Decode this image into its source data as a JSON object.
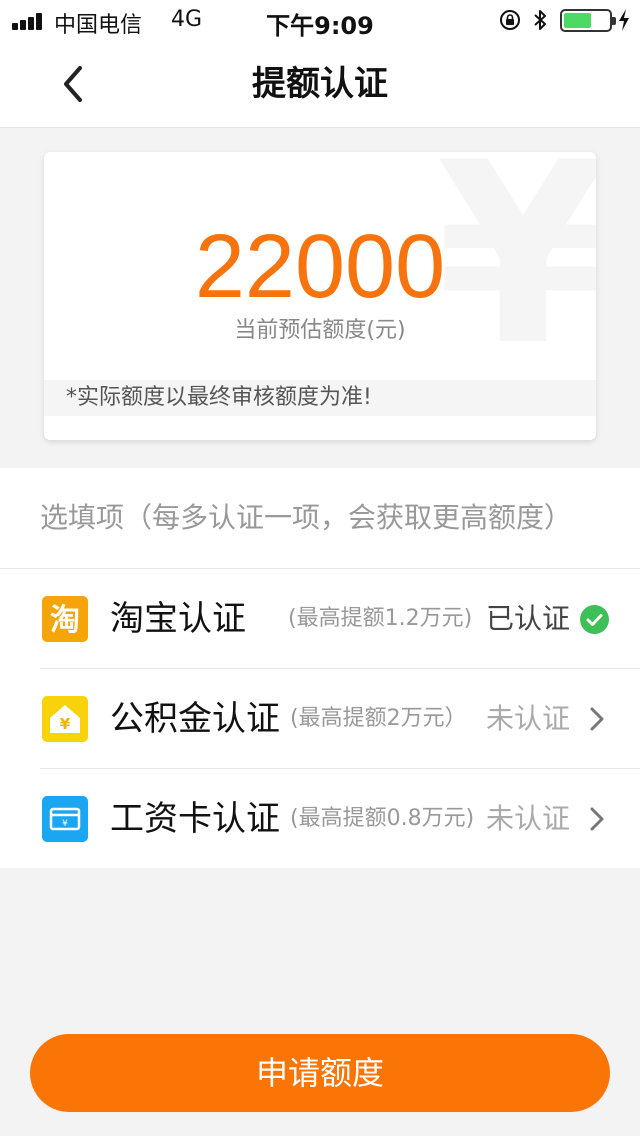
{
  "status_bar": {
    "carrier": "中国电信",
    "network": "4G",
    "time": "下午9:09",
    "battery_level_percent": 65,
    "battery_color": "#4cd964"
  },
  "nav": {
    "back_icon": "chevron-left-icon",
    "title": "提额认证"
  },
  "amount_card": {
    "watermark": "¥",
    "amount": "22000",
    "caption": "当前预估额度(元)",
    "note": "*实际额度以最终审核额度为准!",
    "accent_color": "#f7730e"
  },
  "options": {
    "header": "选填项（每多认证一项，会获取更高额度）",
    "items": [
      {
        "icon": "taobao-icon",
        "icon_glyph": "淘",
        "icon_color": "#f5a50a",
        "title": "淘宝认证",
        "hint": "(最高提额1.2万元)",
        "status": "已认证",
        "status_icon": "check-circle-icon",
        "status_color": "#3fbf58"
      },
      {
        "icon": "house-fund-icon",
        "icon_glyph": "¥",
        "icon_color": "#f8d20a",
        "title": "公积金认证",
        "hint": "(最高提额2万元）",
        "status": "未认证",
        "status_icon": "chevron-right-icon"
      },
      {
        "icon": "salary-card-icon",
        "icon_glyph": "¥",
        "icon_color": "#1aa6f0",
        "title": "工资卡认证",
        "hint": "(最高提额0.8万元)",
        "status": "未认证",
        "status_icon": "chevron-right-icon"
      }
    ]
  },
  "apply_button": {
    "label": "申请额度",
    "color": "#fa7406"
  }
}
